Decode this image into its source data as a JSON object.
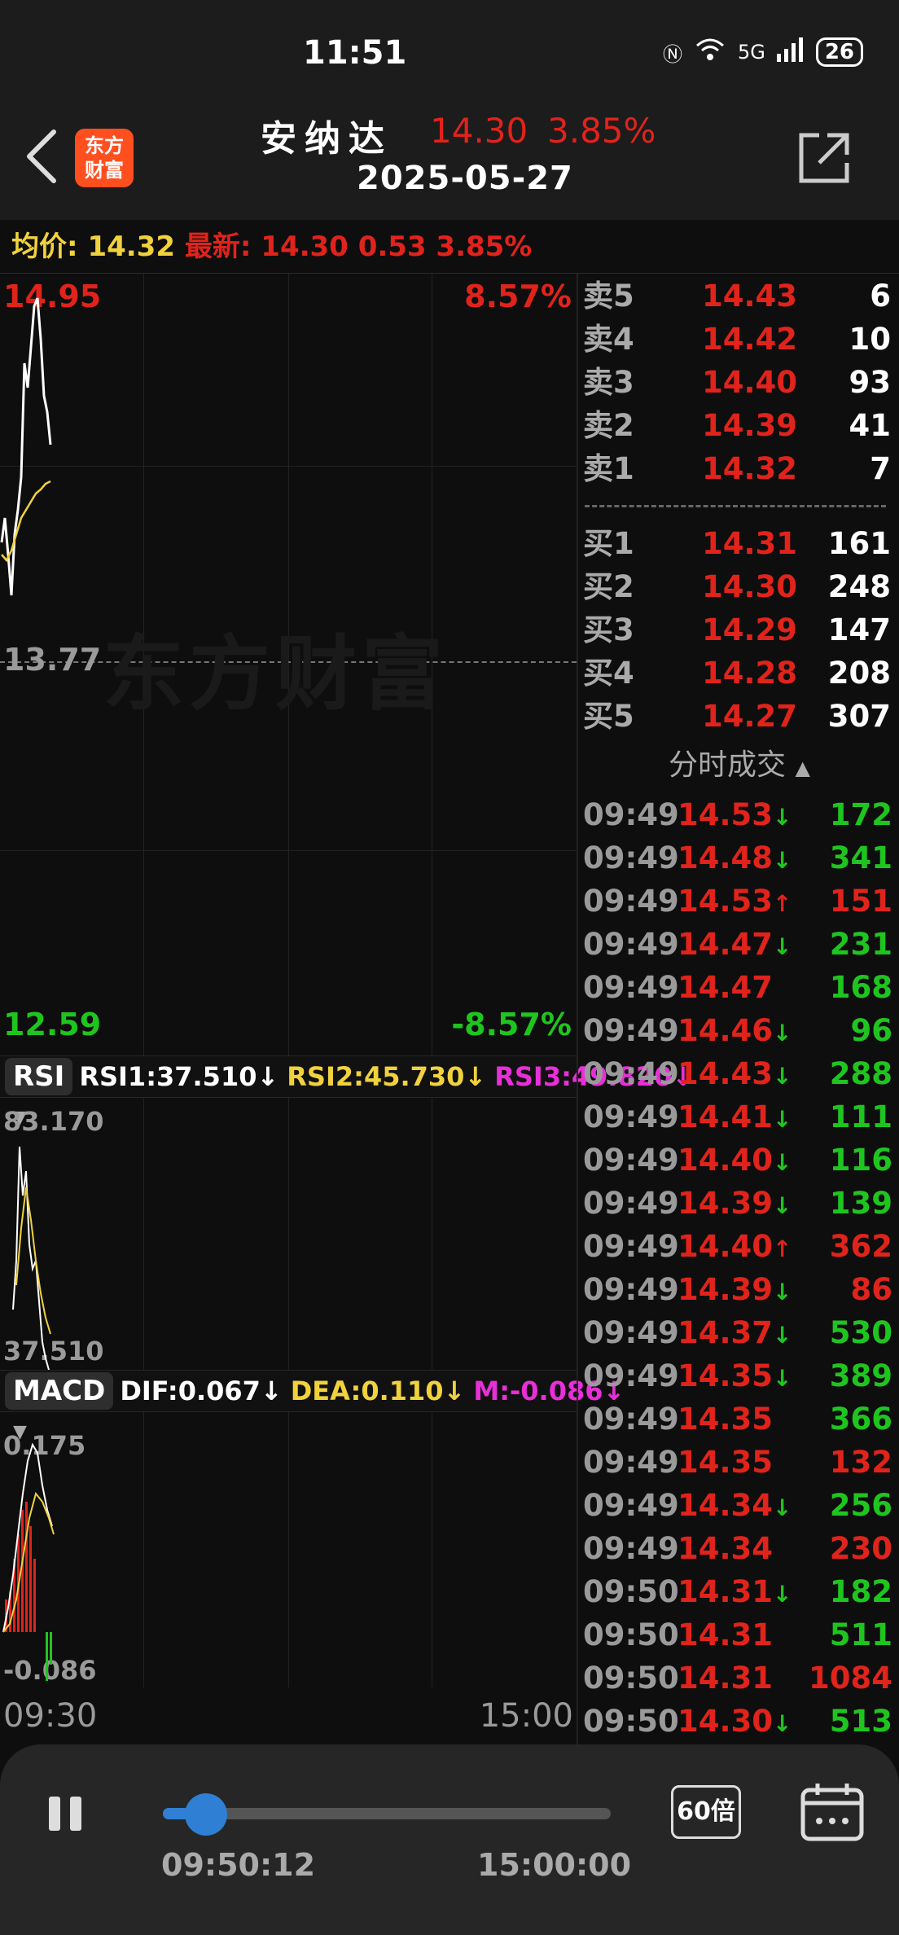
{
  "status_bar": {
    "time": "11:51",
    "battery": "26",
    "net": "5G"
  },
  "header": {
    "name": "安纳达",
    "price": "14.30",
    "change_pct": "3.85%",
    "date": "2025-05-27",
    "logo_line1": "东方",
    "logo_line2": "财富"
  },
  "info": {
    "avg_label": "均价:",
    "avg_value": "14.32",
    "latest_label": "最新:",
    "latest_price": "14.30",
    "change": "0.53",
    "change_pct": "3.85%"
  },
  "chart": {
    "top_price": "14.95",
    "top_pct": "8.57%",
    "mid_price": "13.77",
    "bottom_price": "12.59",
    "bottom_pct": "-8.57%",
    "watermark": "东方财富",
    "time_start": "09:30",
    "time_end": "15:00"
  },
  "rsi": {
    "selector": "RSI",
    "rsi1": "RSI1:37.510↓",
    "rsi2": "RSI2:45.730↓",
    "rsi3": "RSI3:49.820↓",
    "max": "83.170",
    "min": "37.510"
  },
  "macd": {
    "selector": "MACD",
    "dif": "DIF:0.067↓",
    "dea": "DEA:0.110↓",
    "m": "M:-0.086↓",
    "max": "0.175",
    "min": "-0.086"
  },
  "order_book": {
    "asks": [
      {
        "label": "卖5",
        "price": "14.43",
        "vol": "6"
      },
      {
        "label": "卖4",
        "price": "14.42",
        "vol": "10"
      },
      {
        "label": "卖3",
        "price": "14.40",
        "vol": "93"
      },
      {
        "label": "卖2",
        "price": "14.39",
        "vol": "41"
      },
      {
        "label": "卖1",
        "price": "14.32",
        "vol": "7"
      }
    ],
    "bids": [
      {
        "label": "买1",
        "price": "14.31",
        "vol": "161"
      },
      {
        "label": "买2",
        "price": "14.30",
        "vol": "248"
      },
      {
        "label": "买3",
        "price": "14.29",
        "vol": "147"
      },
      {
        "label": "买4",
        "price": "14.28",
        "vol": "208"
      },
      {
        "label": "买5",
        "price": "14.27",
        "vol": "307"
      }
    ]
  },
  "trades_title": "分时成交",
  "trades": [
    {
      "time": "09:49",
      "price": "14.53",
      "dir": "↓",
      "vol": "172",
      "vol_color": "green"
    },
    {
      "time": "09:49",
      "price": "14.48",
      "dir": "↓",
      "vol": "341",
      "vol_color": "green"
    },
    {
      "time": "09:49",
      "price": "14.53",
      "dir": "↑",
      "vol": "151",
      "vol_color": "red"
    },
    {
      "time": "09:49",
      "price": "14.47",
      "dir": "↓",
      "vol": "231",
      "vol_color": "green"
    },
    {
      "time": "09:49",
      "price": "14.47",
      "dir": "",
      "vol": "168",
      "vol_color": "green"
    },
    {
      "time": "09:49",
      "price": "14.46",
      "dir": "↓",
      "vol": "96",
      "vol_color": "green"
    },
    {
      "time": "09:49",
      "price": "14.43",
      "dir": "↓",
      "vol": "288",
      "vol_color": "green"
    },
    {
      "time": "09:49",
      "price": "14.41",
      "dir": "↓",
      "vol": "111",
      "vol_color": "green"
    },
    {
      "time": "09:49",
      "price": "14.40",
      "dir": "↓",
      "vol": "116",
      "vol_color": "green"
    },
    {
      "time": "09:49",
      "price": "14.39",
      "dir": "↓",
      "vol": "139",
      "vol_color": "green"
    },
    {
      "time": "09:49",
      "price": "14.40",
      "dir": "↑",
      "vol": "362",
      "vol_color": "red"
    },
    {
      "time": "09:49",
      "price": "14.39",
      "dir": "↓",
      "vol": "86",
      "vol_color": "red"
    },
    {
      "time": "09:49",
      "price": "14.37",
      "dir": "↓",
      "vol": "530",
      "vol_color": "green"
    },
    {
      "time": "09:49",
      "price": "14.35",
      "dir": "↓",
      "vol": "389",
      "vol_color": "green"
    },
    {
      "time": "09:49",
      "price": "14.35",
      "dir": "",
      "vol": "366",
      "vol_color": "green"
    },
    {
      "time": "09:49",
      "price": "14.35",
      "dir": "",
      "vol": "132",
      "vol_color": "red"
    },
    {
      "time": "09:49",
      "price": "14.34",
      "dir": "↓",
      "vol": "256",
      "vol_color": "green"
    },
    {
      "time": "09:49",
      "price": "14.34",
      "dir": "",
      "vol": "230",
      "vol_color": "red"
    },
    {
      "time": "09:50",
      "price": "14.31",
      "dir": "↓",
      "vol": "182",
      "vol_color": "green"
    },
    {
      "time": "09:50",
      "price": "14.31",
      "dir": "",
      "vol": "511",
      "vol_color": "green"
    },
    {
      "time": "09:50",
      "price": "14.31",
      "dir": "",
      "vol": "1084",
      "vol_color": "red"
    },
    {
      "time": "09:50",
      "price": "14.30",
      "dir": "↓",
      "vol": "513",
      "vol_color": "green"
    }
  ],
  "player": {
    "current": "09:50:12",
    "end": "15:00:00",
    "speed": "60倍",
    "progress": 0.06
  },
  "colors": {
    "red": "#e0231b",
    "green": "#1fc51f",
    "yellow": "#f1d23c",
    "magenta": "#e82fd8"
  }
}
